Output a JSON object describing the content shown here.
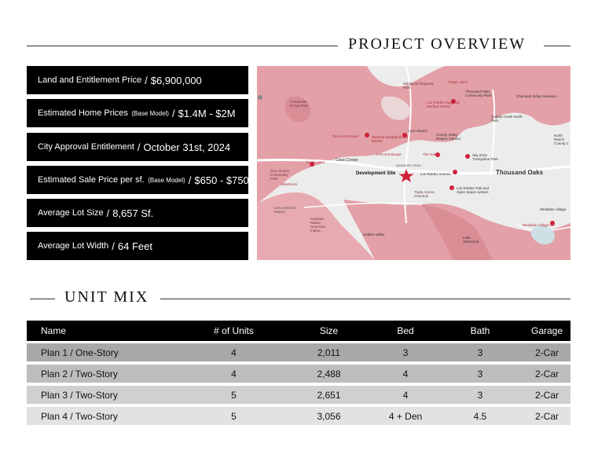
{
  "overview": {
    "title": "PROJECT OVERVIEW",
    "items": [
      {
        "label": "Land and Entitlement Price",
        "note": "",
        "value": "$6,900,000"
      },
      {
        "label": "Estimated Home Prices",
        "note": "(Base Model)",
        "value": "$1.4M - $2M"
      },
      {
        "label": "City Approval Entitlement",
        "note": "",
        "value": "October 31st, 2024"
      },
      {
        "label": "Estimated Sale Price per sf.",
        "note": "(Base Model)",
        "value": "$650 - $750"
      },
      {
        "label": "Average Lot Size",
        "note": "",
        "value": "8,657 Sf."
      },
      {
        "label": "Average Lot Width",
        "note": "",
        "value": "64 Feet"
      }
    ],
    "separator": "/"
  },
  "map": {
    "labels": {
      "wildwood": "Wildwood Regional Park",
      "traderjoes1": "Trader Joe's",
      "thousand_oaks_center": "Thousand Oaks Community Park",
      "chumash": "Chumash Indian Museum",
      "los_robles_med": "Los Robles Regional Medical Center",
      "conejo_creek_north": "Conejo Creek North Park",
      "north_ranch": "North Ranch County C",
      "comanche": "Comanche Grove Park",
      "lynn_ranch": "Lynn Ranch",
      "home_depot": "The Home Depot",
      "walmart": "Walmart Neighborhood Market",
      "conejo_valley": "Conejo Valley Botanic Garden",
      "innout": "In-N-Out Burger",
      "oaks": "The Oaks",
      "sky_zone": "Sky Zone Trampoline Park",
      "casa_conejo": "Casa Conejo",
      "traderjoes2": "Trader Joe's",
      "newbury": "NEWBURY PARK",
      "dev_site": "Development Site",
      "los_robles_greens": "Los Robles Greens",
      "thousand_oaks_city": "Thousand Oaks",
      "dos_vientos": "Dos Vientos Community Park",
      "albertsons": "Albertsons",
      "los_robles_trail": "Los Robles Trail and Open Space system",
      "triple_aurora": "Triple Aurora Overlook",
      "dos_vientos_ranch": "DOS VIENTOS RANCH",
      "satwiwa": "Satwiwa Native American Indian...",
      "hidden_valley": "Hidden Valley",
      "lake_sherwood": "Lake Sherwood",
      "westlake_village_inn": "Westlake Village Inn",
      "westlake_village": "Westlake Village"
    }
  },
  "unit_mix": {
    "title": "UNIT MIX",
    "headers": [
      "Name",
      "# of Units",
      "Size",
      "Bed",
      "Bath",
      "Garage"
    ],
    "rows": [
      [
        "Plan 1 / One-Story",
        "4",
        "2,011",
        "3",
        "3",
        "2-Car"
      ],
      [
        "Plan 2 / Two-Story",
        "4",
        "2,488",
        "4",
        "3",
        "2-Car"
      ],
      [
        "Plan 3 / Two-Story",
        "5",
        "2,651",
        "4",
        "3",
        "2-Car"
      ],
      [
        "Plan 4 / Two-Story",
        "5",
        "3,056",
        "4 + Den",
        "4.5",
        "2-Car"
      ]
    ],
    "row_colors": [
      "#a8a8a8",
      "#bdbdbd",
      "#d0d0d0",
      "#e2e2e2"
    ]
  },
  "colors": {
    "header_bg": "#000000",
    "map_overlay": "#e3a0a6",
    "marker": "#d0203a"
  }
}
